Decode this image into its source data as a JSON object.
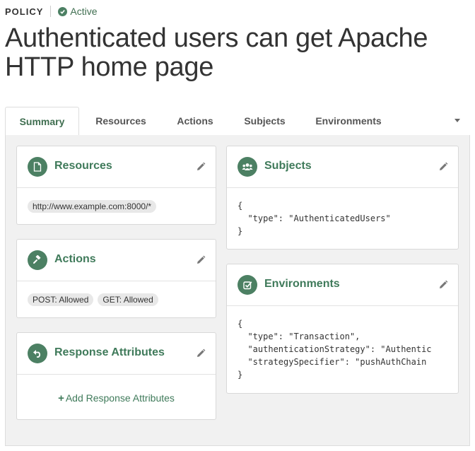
{
  "header": {
    "kicker": "POLICY",
    "status": "Active",
    "title": "Authenticated users can get Apache HTTP home page"
  },
  "tabs": [
    {
      "label": "Summary",
      "active": true
    },
    {
      "label": "Resources"
    },
    {
      "label": "Actions"
    },
    {
      "label": "Subjects"
    },
    {
      "label": "Environments"
    }
  ],
  "cards": {
    "resources": {
      "title": "Resources",
      "icon": "file-icon",
      "items": [
        "http://www.example.com:8000/*"
      ]
    },
    "actions": {
      "title": "Actions",
      "icon": "gavel-icon",
      "items": [
        "POST: Allowed",
        "GET: Allowed"
      ]
    },
    "response": {
      "title": "Response Attributes",
      "icon": "undo-icon",
      "add_label": "Add Response Attributes"
    },
    "subjects": {
      "title": "Subjects",
      "icon": "users-icon",
      "code": "{\n  \"type\": \"AuthenticatedUsers\"\n}"
    },
    "environments": {
      "title": "Environments",
      "icon": "checkbox-icon",
      "code": "{\n  \"type\": \"Transaction\",\n  \"authenticationStrategy\": \"Authentic\n  \"strategySpecifier\": \"pushAuthChain\n}"
    }
  },
  "colors": {
    "accent": "#4c8063",
    "accent_text": "#3f7a5a"
  }
}
